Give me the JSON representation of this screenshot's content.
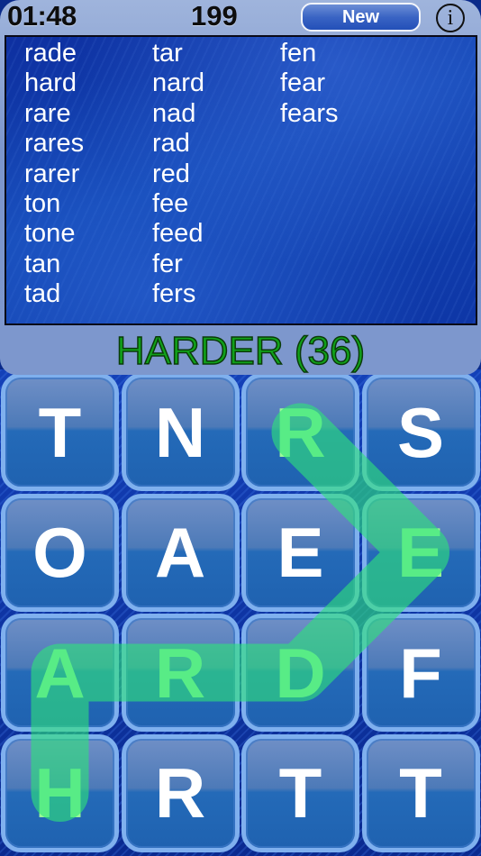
{
  "header": {
    "timer": "01:48",
    "score": "199",
    "new_label": "New",
    "info_icon": "info-icon"
  },
  "found_words": {
    "columns": [
      [
        "rade",
        "hard",
        "rare",
        "rares",
        "rarer",
        "ton",
        "tone",
        "tan",
        "tad"
      ],
      [
        "tar",
        "nard",
        "nad",
        "rad",
        "red",
        "fee",
        "feed",
        "fer",
        "fers"
      ],
      [
        "fen",
        "fear",
        "fears"
      ]
    ]
  },
  "status": {
    "current_word": "HARDER (36)",
    "color": "#11a11a"
  },
  "board": {
    "rows": [
      [
        "T",
        "N",
        "R",
        "S"
      ],
      [
        "O",
        "A",
        "E",
        "E"
      ],
      [
        "A",
        "R",
        "D",
        "F"
      ],
      [
        "H",
        "R",
        "T",
        "T"
      ]
    ],
    "selected_path": [
      [
        3,
        0
      ],
      [
        2,
        0
      ],
      [
        2,
        1
      ],
      [
        2,
        2
      ],
      [
        1,
        3
      ],
      [
        0,
        2
      ]
    ],
    "path_color": "#2ee27a",
    "selected_letter_color": "#9cfb98"
  }
}
